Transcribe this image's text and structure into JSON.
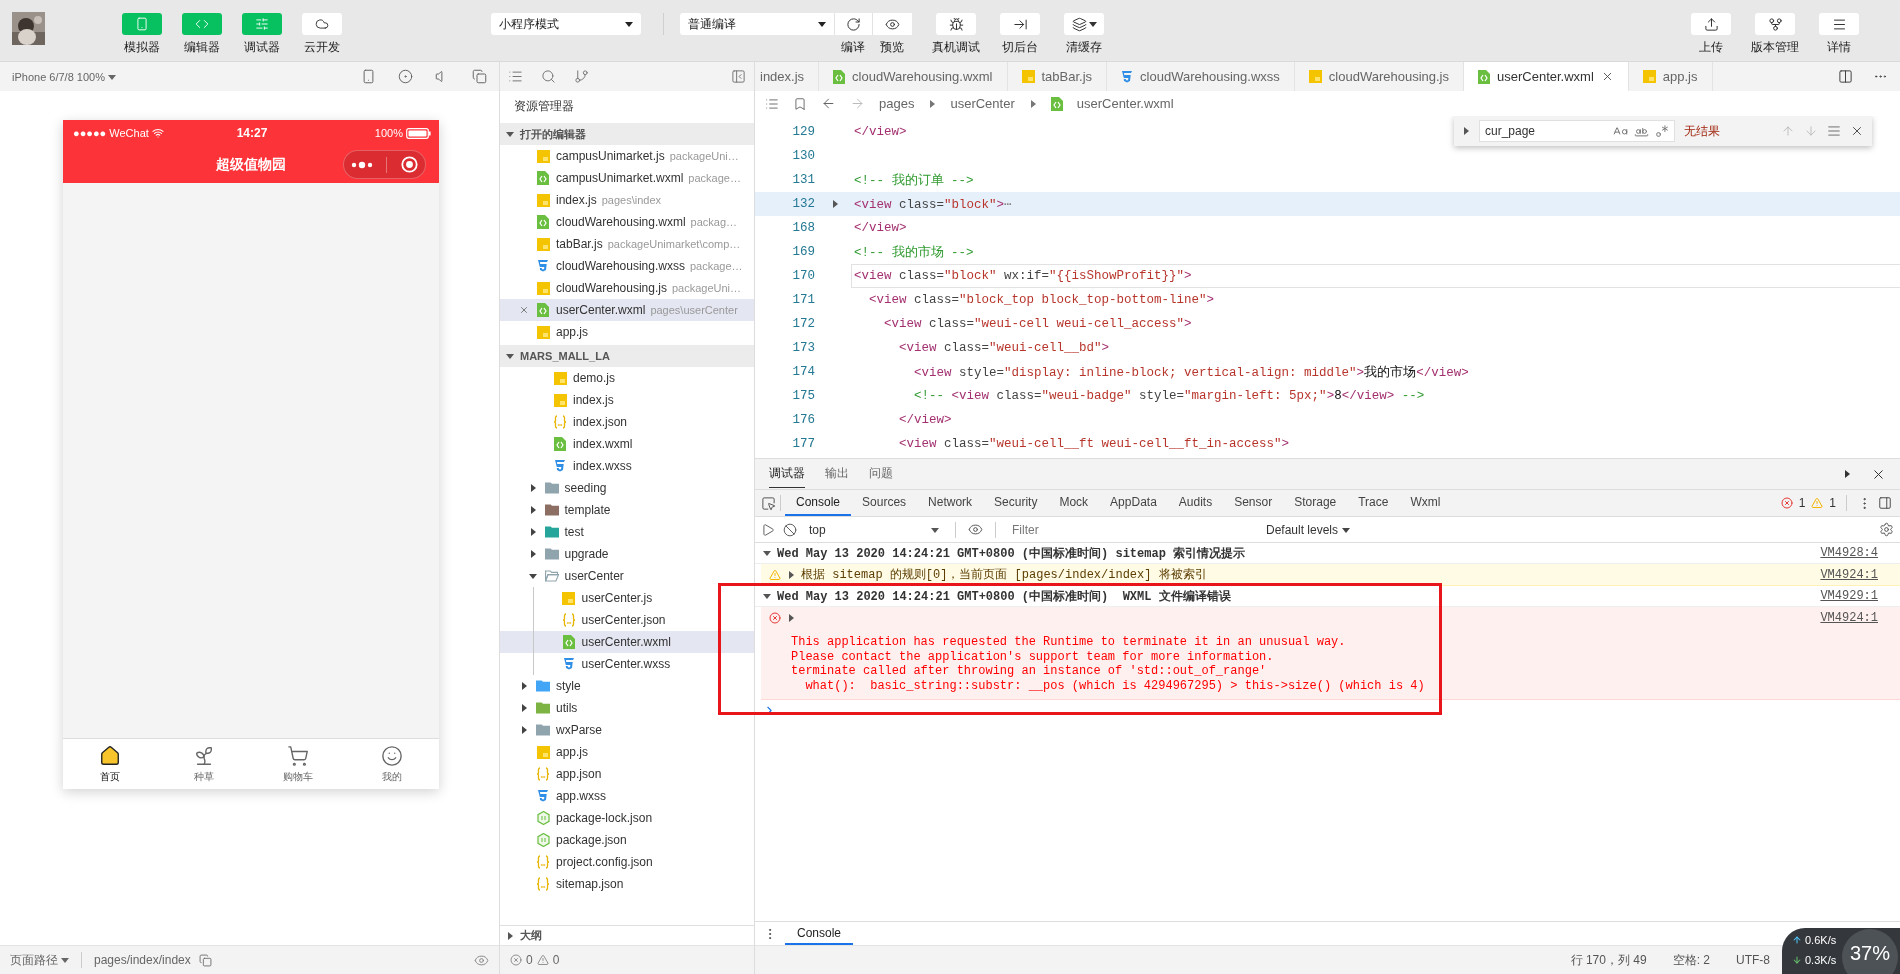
{
  "toolbar": {
    "left_buttons": [
      {
        "label": "模拟器",
        "on": true
      },
      {
        "label": "编辑器",
        "on": true
      },
      {
        "label": "调试器",
        "on": true
      },
      {
        "label": "云开发",
        "on": false
      }
    ],
    "mode_select": "小程序模式",
    "compile_select": "普通编译",
    "compile_buttons": [
      "编译",
      "预览"
    ],
    "tool_buttons": [
      "真机调试",
      "切后台",
      "清缓存"
    ],
    "right_buttons": [
      "上传",
      "版本管理",
      "详情"
    ]
  },
  "simulator": {
    "device": "iPhone 6/7/8 100%",
    "phone": {
      "carrier": "●●●●● WeChat",
      "time": "14:27",
      "battery": "100%",
      "title": "超级值物园",
      "tabs": [
        {
          "label": "首页",
          "selected": true
        },
        {
          "label": "种草",
          "selected": false
        },
        {
          "label": "购物车",
          "selected": false
        },
        {
          "label": "我的",
          "selected": false
        }
      ]
    },
    "footer": {
      "label": "页面路径",
      "path": "pages/index/index"
    }
  },
  "explorer": {
    "title": "资源管理器",
    "open_editors": {
      "title": "打开的编辑器",
      "expanded": true,
      "items": [
        {
          "name": "campusUnimarket.js",
          "hint": "packageUni…",
          "kind": "js",
          "selected": false
        },
        {
          "name": "campusUnimarket.wxml",
          "hint": "package…",
          "kind": "wxml",
          "selected": false
        },
        {
          "name": "index.js",
          "hint": "pages\\index",
          "kind": "js",
          "selected": false
        },
        {
          "name": "cloudWarehousing.wxml",
          "hint": "packag…",
          "kind": "wxml",
          "selected": false
        },
        {
          "name": "tabBar.js",
          "hint": "packageUnimarket\\comp…",
          "kind": "js",
          "selected": false
        },
        {
          "name": "cloudWarehousing.wxss",
          "hint": "package…",
          "kind": "wxss",
          "selected": false
        },
        {
          "name": "cloudWarehousing.js",
          "hint": "packageUni…",
          "kind": "js",
          "selected": false
        },
        {
          "name": "userCenter.wxml",
          "hint": "pages\\userCenter",
          "kind": "wxml",
          "selected": true
        },
        {
          "name": "app.js",
          "kind": "js",
          "selected": false
        }
      ]
    },
    "project": {
      "title": "MARS_MALL_LA",
      "expanded": true,
      "children": [
        {
          "kind": "scrolled",
          "children": [
            {
              "kind": "scrolled",
              "children": [
                {
                  "name": "demo.js",
                  "kind": "js",
                  "selected": false
                },
                {
                  "name": "index.js",
                  "kind": "js",
                  "selected": false
                },
                {
                  "name": "index.json",
                  "kind": "json",
                  "selected": false
                },
                {
                  "name": "index.wxml",
                  "kind": "wxml",
                  "selected": false
                },
                {
                  "name": "index.wxss",
                  "kind": "wxss",
                  "selected": false
                }
              ]
            },
            {
              "name": "seeding",
              "kind": "folder",
              "color": "#90a4ae",
              "expanded": false,
              "selected": false
            },
            {
              "name": "template",
              "kind": "folder",
              "color": "#8d6e63",
              "expanded": false,
              "selected": false
            },
            {
              "name": "test",
              "kind": "folder",
              "color": "#26a69a",
              "expanded": false,
              "selected": false
            },
            {
              "name": "upgrade",
              "kind": "folder",
              "color": "#90a4ae",
              "expanded": false,
              "selected": false
            },
            {
              "name": "userCenter",
              "kind": "folder",
              "color": "#90a4ae",
              "expanded": true,
              "selected": false,
              "children": [
                {
                  "name": "userCenter.js",
                  "kind": "js",
                  "selected": false
                },
                {
                  "name": "userCenter.json",
                  "kind": "json",
                  "selected": false
                },
                {
                  "name": "userCenter.wxml",
                  "kind": "wxml",
                  "selected": true
                },
                {
                  "name": "userCenter.wxss",
                  "kind": "wxss",
                  "selected": false
                }
              ]
            }
          ]
        },
        {
          "name": "style",
          "kind": "folder",
          "color": "#42a5f5",
          "expanded": false,
          "selected": false
        },
        {
          "name": "utils",
          "kind": "folder",
          "color": "#7cb342",
          "expanded": false,
          "selected": false
        },
        {
          "name": "wxParse",
          "kind": "folder",
          "color": "#90a4ae",
          "expanded": false,
          "selected": false
        },
        {
          "name": "app.js",
          "kind": "js",
          "selected": false
        },
        {
          "name": "app.json",
          "kind": "json",
          "selected": false
        },
        {
          "name": "app.wxss",
          "kind": "wxss",
          "selected": false
        },
        {
          "name": "package-lock.json",
          "kind": "node",
          "selected": false
        },
        {
          "name": "package.json",
          "kind": "node",
          "selected": false
        },
        {
          "name": "project.config.json",
          "kind": "json",
          "selected": false
        },
        {
          "name": "sitemap.json",
          "kind": "json",
          "selected": false
        }
      ]
    },
    "outline": {
      "title": "大纲",
      "expanded": false
    },
    "status": {
      "errors": "0",
      "warnings": "0"
    }
  },
  "editor": {
    "tabs": [
      {
        "name": "index.js",
        "selected": false
      },
      {
        "name": "cloudWarehousing.wxml",
        "kind": "wxml",
        "selected": false
      },
      {
        "name": "tabBar.js",
        "kind": "js",
        "selected": false
      },
      {
        "name": "cloudWarehousing.wxss",
        "kind": "wxss",
        "selected": false
      },
      {
        "name": "cloudWarehousing.js",
        "kind": "js",
        "selected": false
      },
      {
        "name": "userCenter.wxml",
        "kind": "wxml",
        "selected": true
      },
      {
        "name": "app.js",
        "kind": "js",
        "selected": false
      }
    ],
    "breadcrumb": [
      {
        "text": "pages"
      },
      {
        "text": "userCenter"
      },
      {
        "text": "userCenter.wxml",
        "kind": "wxml"
      }
    ],
    "find": {
      "value": "cur_page",
      "result": "无结果"
    },
    "lines": [
      {
        "number": "129",
        "folded": false,
        "highlighted": false,
        "current": false,
        "tokens": [
          {
            "kind": "tag",
            "text": "</view>"
          }
        ]
      },
      {
        "number": "130",
        "folded": false,
        "highlighted": false,
        "current": false
      },
      {
        "number": "131",
        "folded": false,
        "highlighted": false,
        "current": false,
        "tokens": [
          {
            "kind": "comment",
            "text": "<!-- 我的订单 -->"
          }
        ]
      },
      {
        "number": "132",
        "folded": true,
        "highlighted": true,
        "current": false,
        "tokens": [
          {
            "kind": "tag",
            "text": "<view"
          },
          {
            "kind": "attr",
            "text": " class="
          },
          {
            "kind": "value",
            "text": "\"block\""
          },
          {
            "kind": "tag",
            "text": ">"
          },
          {
            "kind": "fold",
            "text": "⋯"
          }
        ]
      },
      {
        "number": "168",
        "folded": false,
        "highlighted": false,
        "current": false,
        "tokens": [
          {
            "kind": "tag",
            "text": "</view>"
          }
        ]
      },
      {
        "number": "169",
        "folded": false,
        "highlighted": false,
        "current": false,
        "tokens": [
          {
            "kind": "comment",
            "text": "<!-- 我的市场 -->"
          }
        ]
      },
      {
        "number": "170",
        "folded": false,
        "highlighted": false,
        "current": true,
        "tokens": [
          {
            "kind": "tag",
            "text": "<view"
          },
          {
            "kind": "attr",
            "text": " class="
          },
          {
            "kind": "value",
            "text": "\"block\""
          },
          {
            "kind": "attr",
            "text": " wx:if="
          },
          {
            "kind": "value",
            "text": "\"{{isShowProfit}}\""
          },
          {
            "kind": "tag",
            "text": ">"
          }
        ]
      },
      {
        "number": "171",
        "folded": false,
        "highlighted": false,
        "current": false,
        "tokens": [
          {
            "kind": "tag",
            "text": "  <view"
          },
          {
            "kind": "attr",
            "text": " class="
          },
          {
            "kind": "value",
            "text": "\"block_top block_top-bottom-line\""
          },
          {
            "kind": "tag",
            "text": ">"
          }
        ]
      },
      {
        "number": "172",
        "folded": false,
        "highlighted": false,
        "current": false,
        "tokens": [
          {
            "kind": "tag",
            "text": "    <view"
          },
          {
            "kind": "attr",
            "text": " class="
          },
          {
            "kind": "value",
            "text": "\"weui-cell weui-cell_access\""
          },
          {
            "kind": "tag",
            "text": ">"
          }
        ]
      },
      {
        "number": "173",
        "folded": false,
        "highlighted": false,
        "current": false,
        "tokens": [
          {
            "kind": "tag",
            "text": "      <view"
          },
          {
            "kind": "attr",
            "text": " class="
          },
          {
            "kind": "value",
            "text": "\"weui-cell__bd\""
          },
          {
            "kind": "tag",
            "text": ">"
          }
        ]
      },
      {
        "number": "174",
        "folded": false,
        "highlighted": false,
        "current": false,
        "tokens": [
          {
            "kind": "tag",
            "text": "        <view"
          },
          {
            "kind": "attr",
            "text": " style="
          },
          {
            "kind": "value",
            "text": "\"display: inline-block; vertical-align: middle\""
          },
          {
            "kind": "tag",
            "text": ">"
          },
          {
            "kind": "text",
            "text": "我的市场"
          },
          {
            "kind": "tag",
            "text": "</view>"
          }
        ]
      },
      {
        "number": "175",
        "folded": false,
        "highlighted": false,
        "current": false,
        "tokens": [
          {
            "kind": "comment",
            "text": "        <!-- "
          },
          {
            "kind": "tag",
            "text": "<view"
          },
          {
            "kind": "attr",
            "text": " class="
          },
          {
            "kind": "value",
            "text": "\"weui-badge\""
          },
          {
            "kind": "attr",
            "text": " style="
          },
          {
            "kind": "value",
            "text": "\"margin-left: 5px;\""
          },
          {
            "kind": "tag",
            "text": ">"
          },
          {
            "kind": "text",
            "text": "8"
          },
          {
            "kind": "tag",
            "text": "</view>"
          },
          {
            "kind": "comment",
            "text": " -->"
          }
        ]
      },
      {
        "number": "176",
        "folded": false,
        "highlighted": false,
        "current": false,
        "tokens": [
          {
            "kind": "tag",
            "text": "      </view>"
          }
        ]
      },
      {
        "number": "177",
        "folded": false,
        "highlighted": false,
        "current": false,
        "tokens": [
          {
            "kind": "tag",
            "text": "      <view"
          },
          {
            "kind": "attr",
            "text": " class="
          },
          {
            "kind": "value",
            "text": "\"weui-cell__ft weui-cell__ft_in-access\""
          },
          {
            "kind": "tag",
            "text": ">"
          }
        ]
      }
    ]
  },
  "debugger": {
    "tabs": [
      {
        "label": "调试器",
        "selected": true
      },
      {
        "label": "输出",
        "selected": false
      },
      {
        "label": "问题",
        "selected": false
      }
    ],
    "devtools_tabs": [
      {
        "label": "Console",
        "selected": true
      },
      {
        "label": "Sources",
        "selected": false
      },
      {
        "label": "Network",
        "selected": false
      },
      {
        "label": "Security",
        "selected": false
      },
      {
        "label": "Mock",
        "selected": false
      },
      {
        "label": "AppData",
        "selected": false
      },
      {
        "label": "Audits",
        "selected": false
      },
      {
        "label": "Sensor",
        "selected": false
      },
      {
        "label": "Storage",
        "selected": false
      },
      {
        "label": "Trace",
        "selected": false
      },
      {
        "label": "Wxml",
        "selected": false
      }
    ],
    "error_count": "1",
    "warning_count": "1",
    "context": "top",
    "filter_placeholder": "Filter",
    "levels": "Default levels",
    "log": [
      {
        "kind": "group",
        "expanded": true,
        "text": "Wed May 13 2020 14:24:21 GMT+0800 (中国标准时间) sitemap 索引情况提示",
        "source": "VM4928:4"
      },
      {
        "kind": "warning",
        "expanded": false,
        "text": "根据 sitemap 的规则[0]，当前页面 [pages/index/index] 将被索引",
        "source": "VM4924:1"
      },
      {
        "kind": "group",
        "expanded": true,
        "text": "Wed May 13 2020 14:24:21 GMT+0800 (中国标准时间)  WXML 文件编译错误",
        "source": "VM4929:1"
      },
      {
        "kind": "error",
        "expanded": false,
        "source": "VM4924:1",
        "lines": [
          "This application has requested the Runtime to terminate it in an unusual way.",
          "Please contact the application's support team for more information.",
          "terminate called after throwing an instance of 'std::out_of_range'",
          "  what():  basic_string::substr: __pos (which is 4294967295) > this->size() (which is 4)"
        ]
      }
    ],
    "drawer_tab": "Console"
  },
  "status_bar": {
    "position": "行 170，列 49",
    "indent": "空格: 2",
    "encoding": "UTF-8"
  },
  "net_monitor": {
    "upload": "0.6K/s",
    "download": "0.3K/s",
    "load": "37%"
  },
  "annotation": {
    "kind": "frame"
  }
}
